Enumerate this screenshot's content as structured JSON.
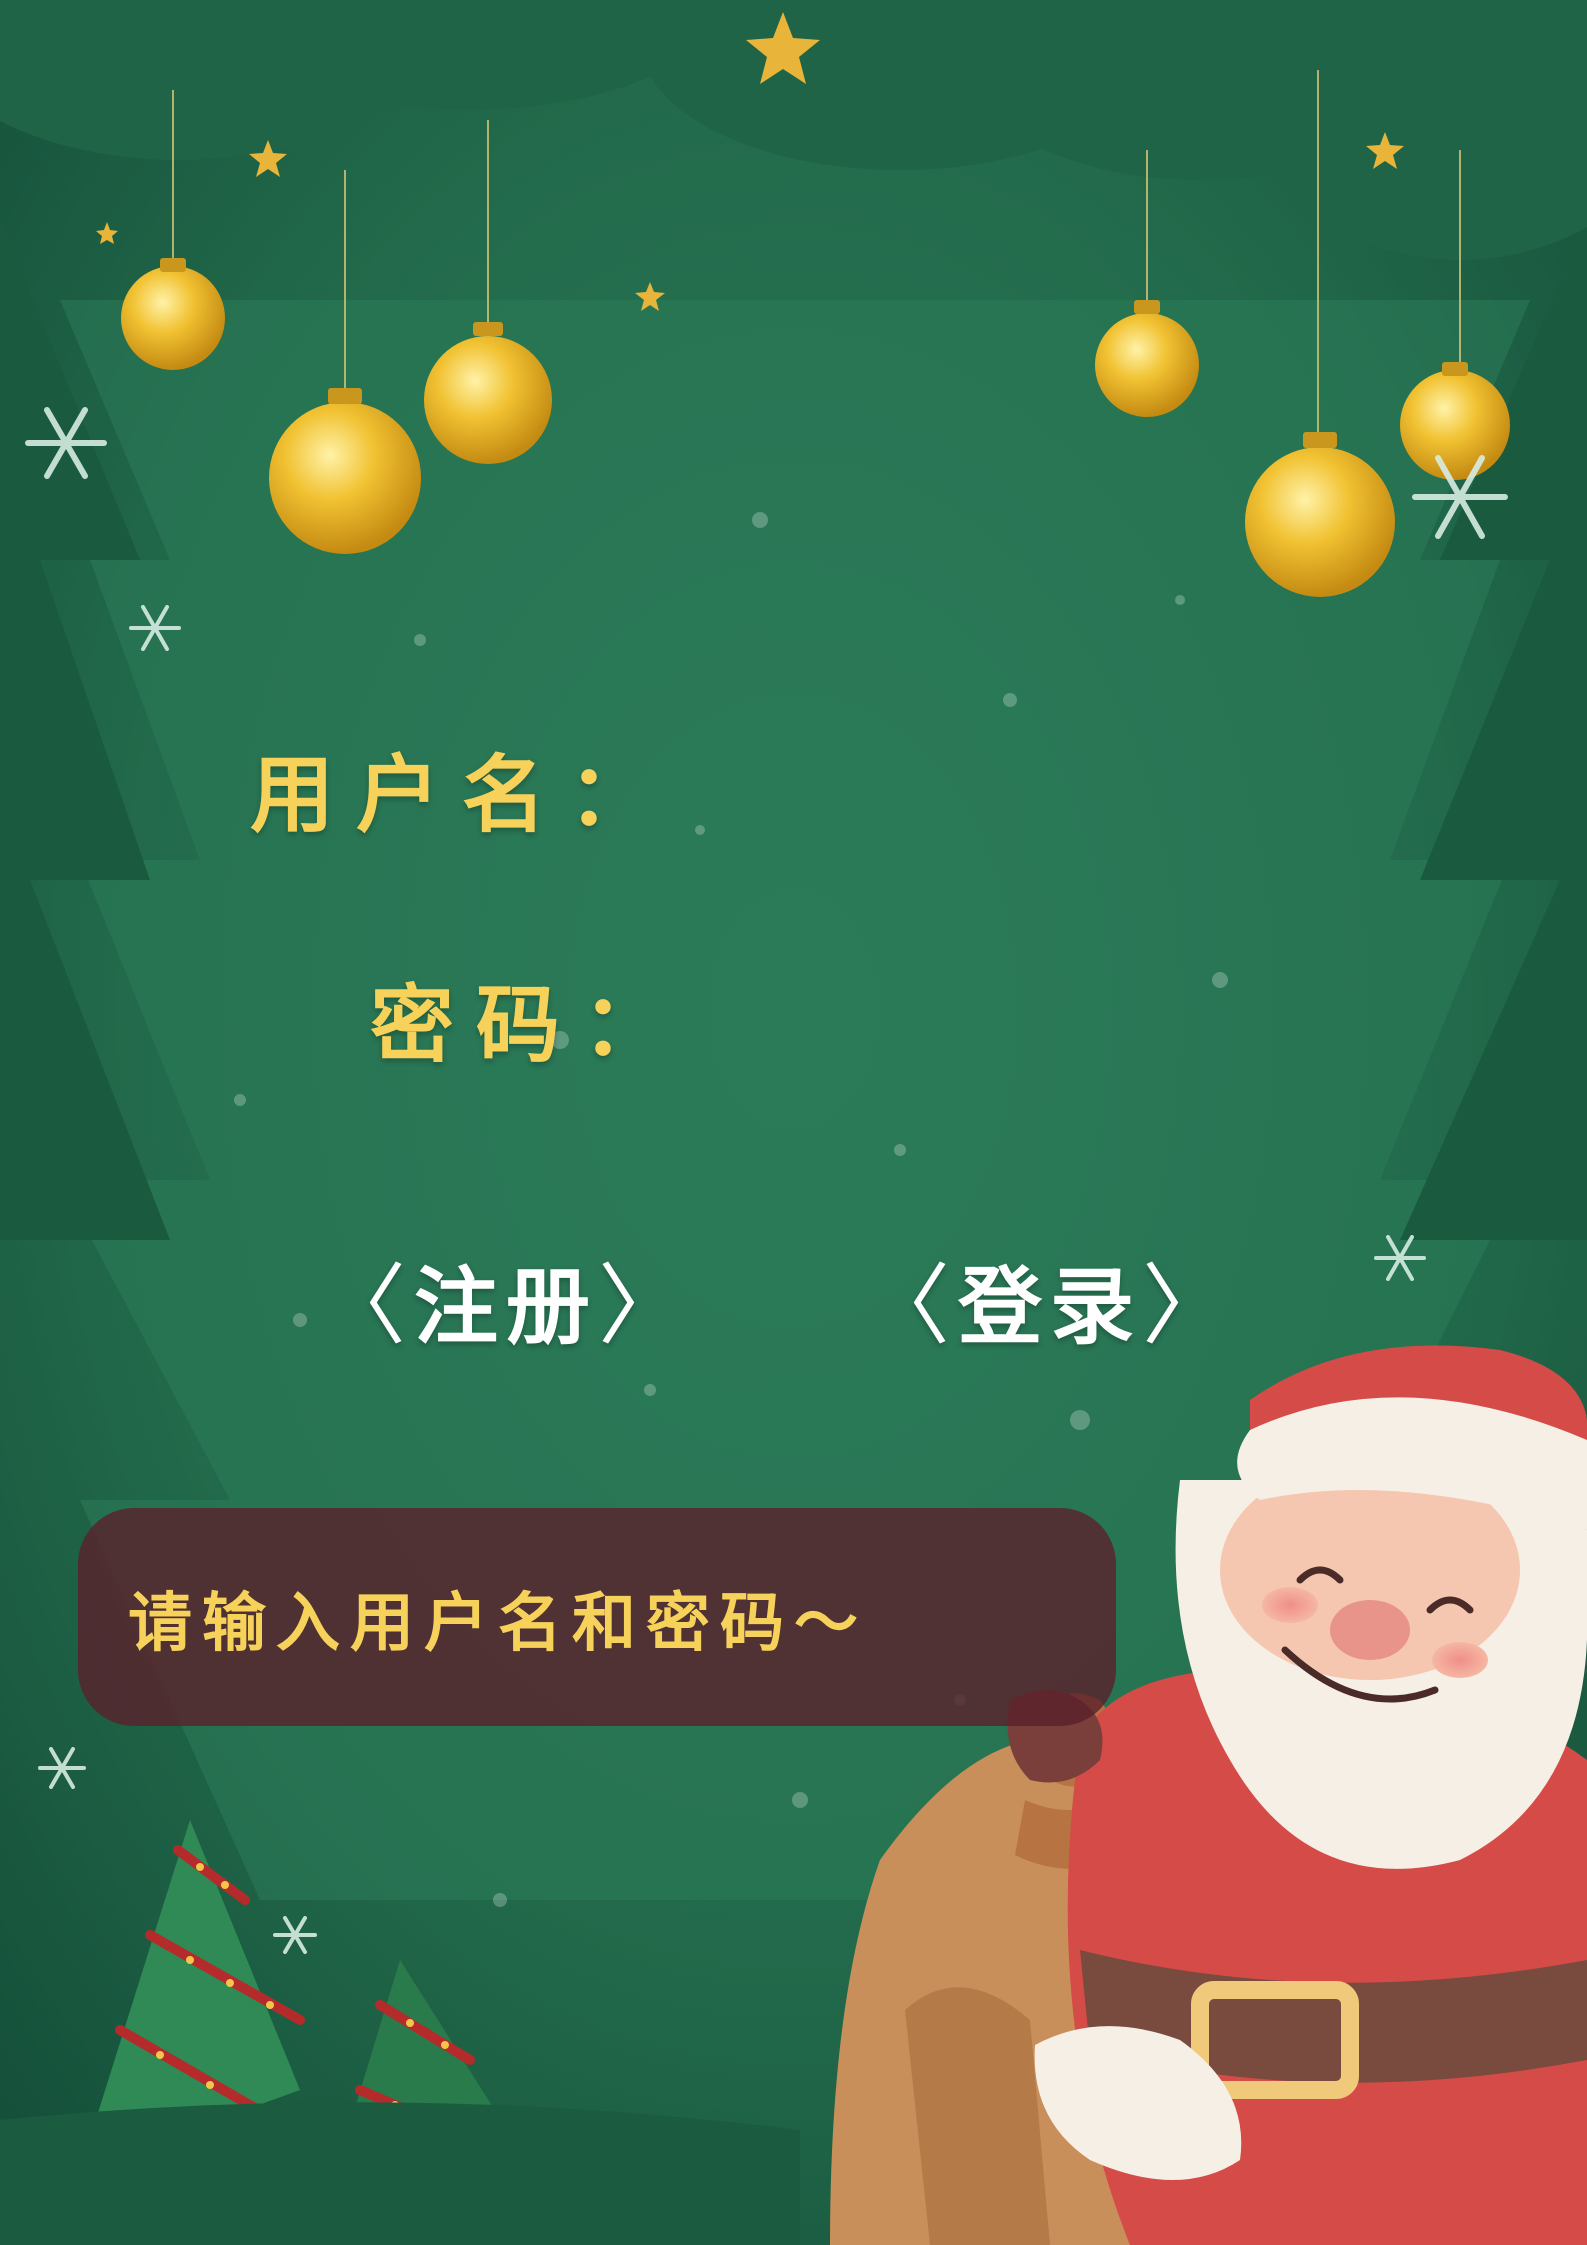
{
  "form": {
    "username_label": "用户名：",
    "password_label": "密码：",
    "username_value": "",
    "password_value": ""
  },
  "actions": {
    "register_label": "注册",
    "login_label": "登录",
    "bracket_open": "〈",
    "bracket_close": "〉"
  },
  "message": {
    "text": "请输入用户名和密码～"
  },
  "colors": {
    "background": "#23684a",
    "label_text": "#f7d25a",
    "action_text": "#ffffff",
    "message_box": "#5a202c"
  }
}
